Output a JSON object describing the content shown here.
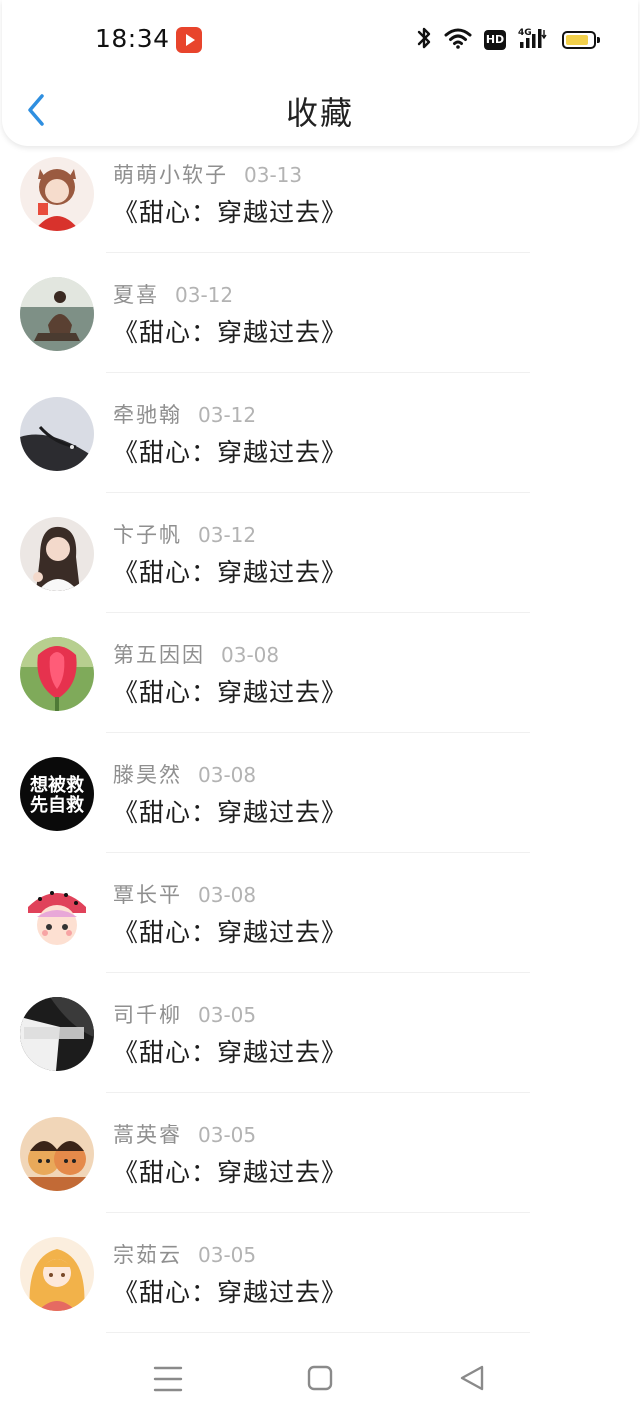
{
  "status_bar": {
    "time": "18:34",
    "hd_label": "HD",
    "network_label": "4G"
  },
  "header": {
    "title": "收藏",
    "back_icon": "chevron-left-icon",
    "accent_color": "#2f8fe0"
  },
  "favorites": [
    {
      "user": "萌萌小软子",
      "date": "03-13",
      "title": "《甜心：穿越过去》"
    },
    {
      "user": "夏喜",
      "date": "03-12",
      "title": "《甜心：穿越过去》"
    },
    {
      "user": "牵驰翰",
      "date": "03-12",
      "title": "《甜心：穿越过去》"
    },
    {
      "user": "卞子帆",
      "date": "03-12",
      "title": "《甜心：穿越过去》"
    },
    {
      "user": "第五因因",
      "date": "03-08",
      "title": "《甜心：穿越过去》"
    },
    {
      "user": "滕昊然",
      "date": "03-08",
      "title": "《甜心：穿越过去》",
      "avatar_text": [
        "想被救",
        "先自救"
      ]
    },
    {
      "user": "覃长平",
      "date": "03-08",
      "title": "《甜心：穿越过去》"
    },
    {
      "user": "司千柳",
      "date": "03-05",
      "title": "《甜心：穿越过去》"
    },
    {
      "user": "蒿英睿",
      "date": "03-05",
      "title": "《甜心：穿越过去》"
    },
    {
      "user": "宗茹云",
      "date": "03-05",
      "title": "《甜心：穿越过去》"
    }
  ],
  "nav_bar": {
    "icons": [
      "menu-icon",
      "home-square-icon",
      "back-triangle-icon"
    ]
  }
}
